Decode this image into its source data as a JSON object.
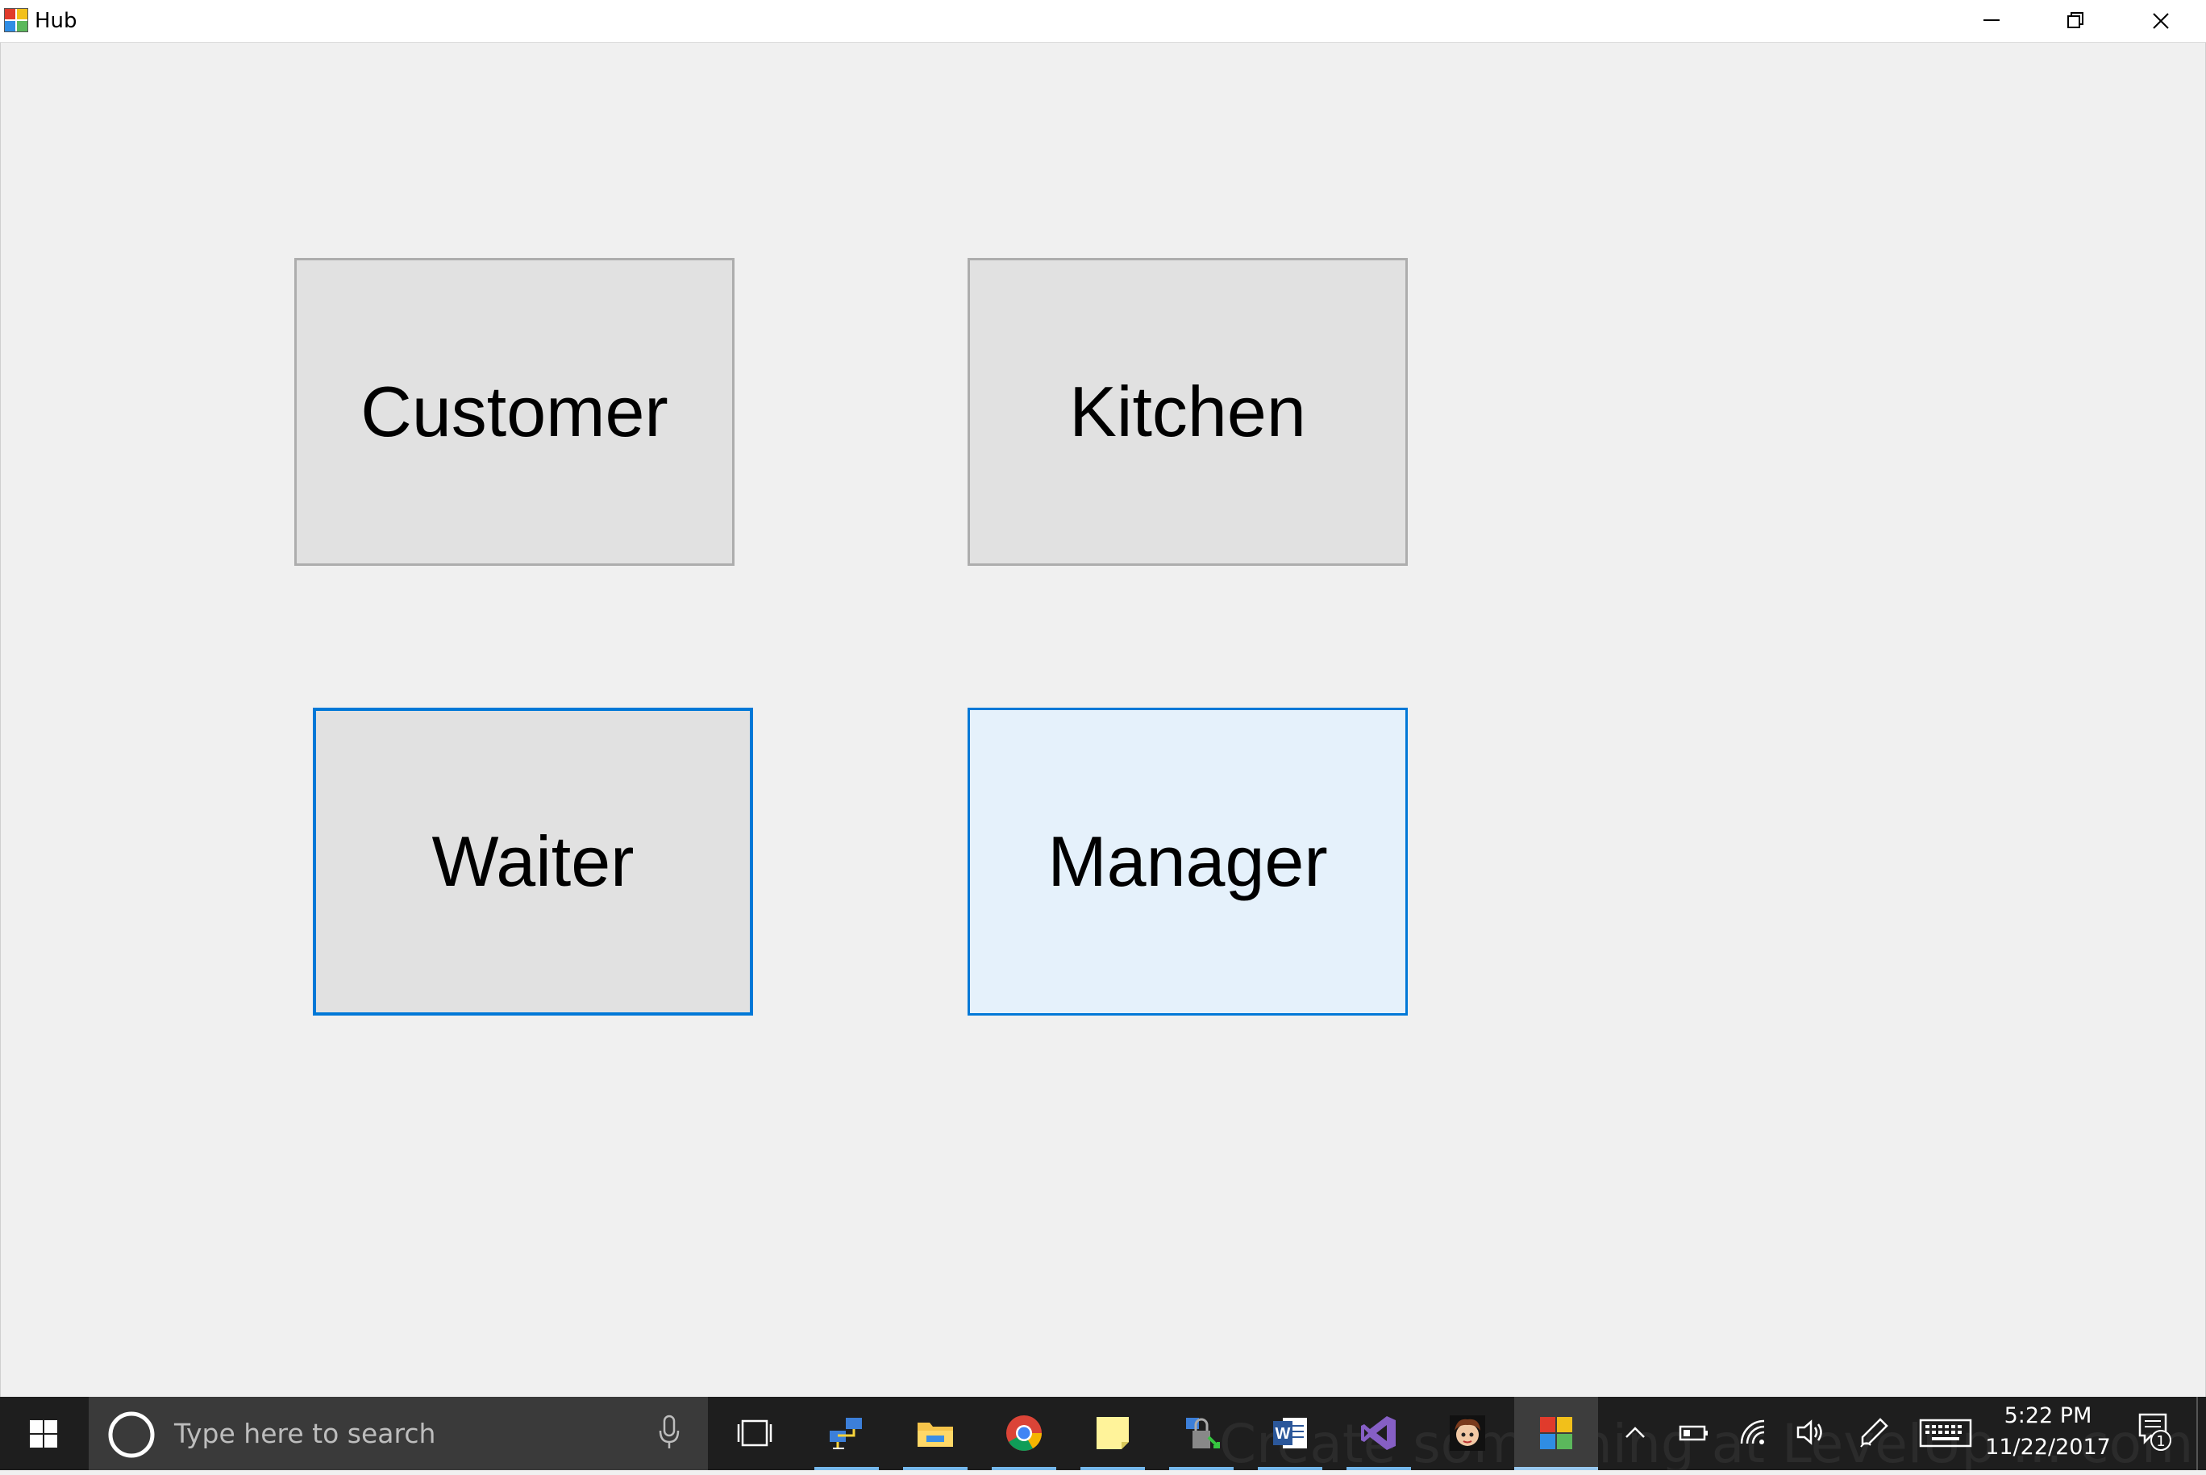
{
  "window": {
    "title": "Hub",
    "controls": [
      "minimize-icon",
      "restore-icon",
      "close-icon"
    ]
  },
  "hub_buttons": {
    "customer": "Customer",
    "kitchen": "Kitchen",
    "waiter": "Waiter",
    "manager": "Manager"
  },
  "colors": {
    "window_bg": "#f0f0f0",
    "button_bg": "#e1e1e1",
    "button_hover_bg": "#e5f1fb",
    "focus_border": "#0078d7",
    "taskbar_bg": "#1e1e1e"
  },
  "taskbar": {
    "search_placeholder": "Type here to search",
    "apps": [
      "network-app-icon",
      "file-explorer-icon",
      "chrome-icon",
      "sticky-notes-icon",
      "security-app-icon",
      "word-icon",
      "visual-studio-icon",
      "game-app-icon",
      "hub-app-icon"
    ],
    "clock": {
      "time": "5:22 PM",
      "date": "11/22/2017"
    },
    "notifications_count": "1",
    "ghost_text": "Create something at LevelUp ... com"
  }
}
